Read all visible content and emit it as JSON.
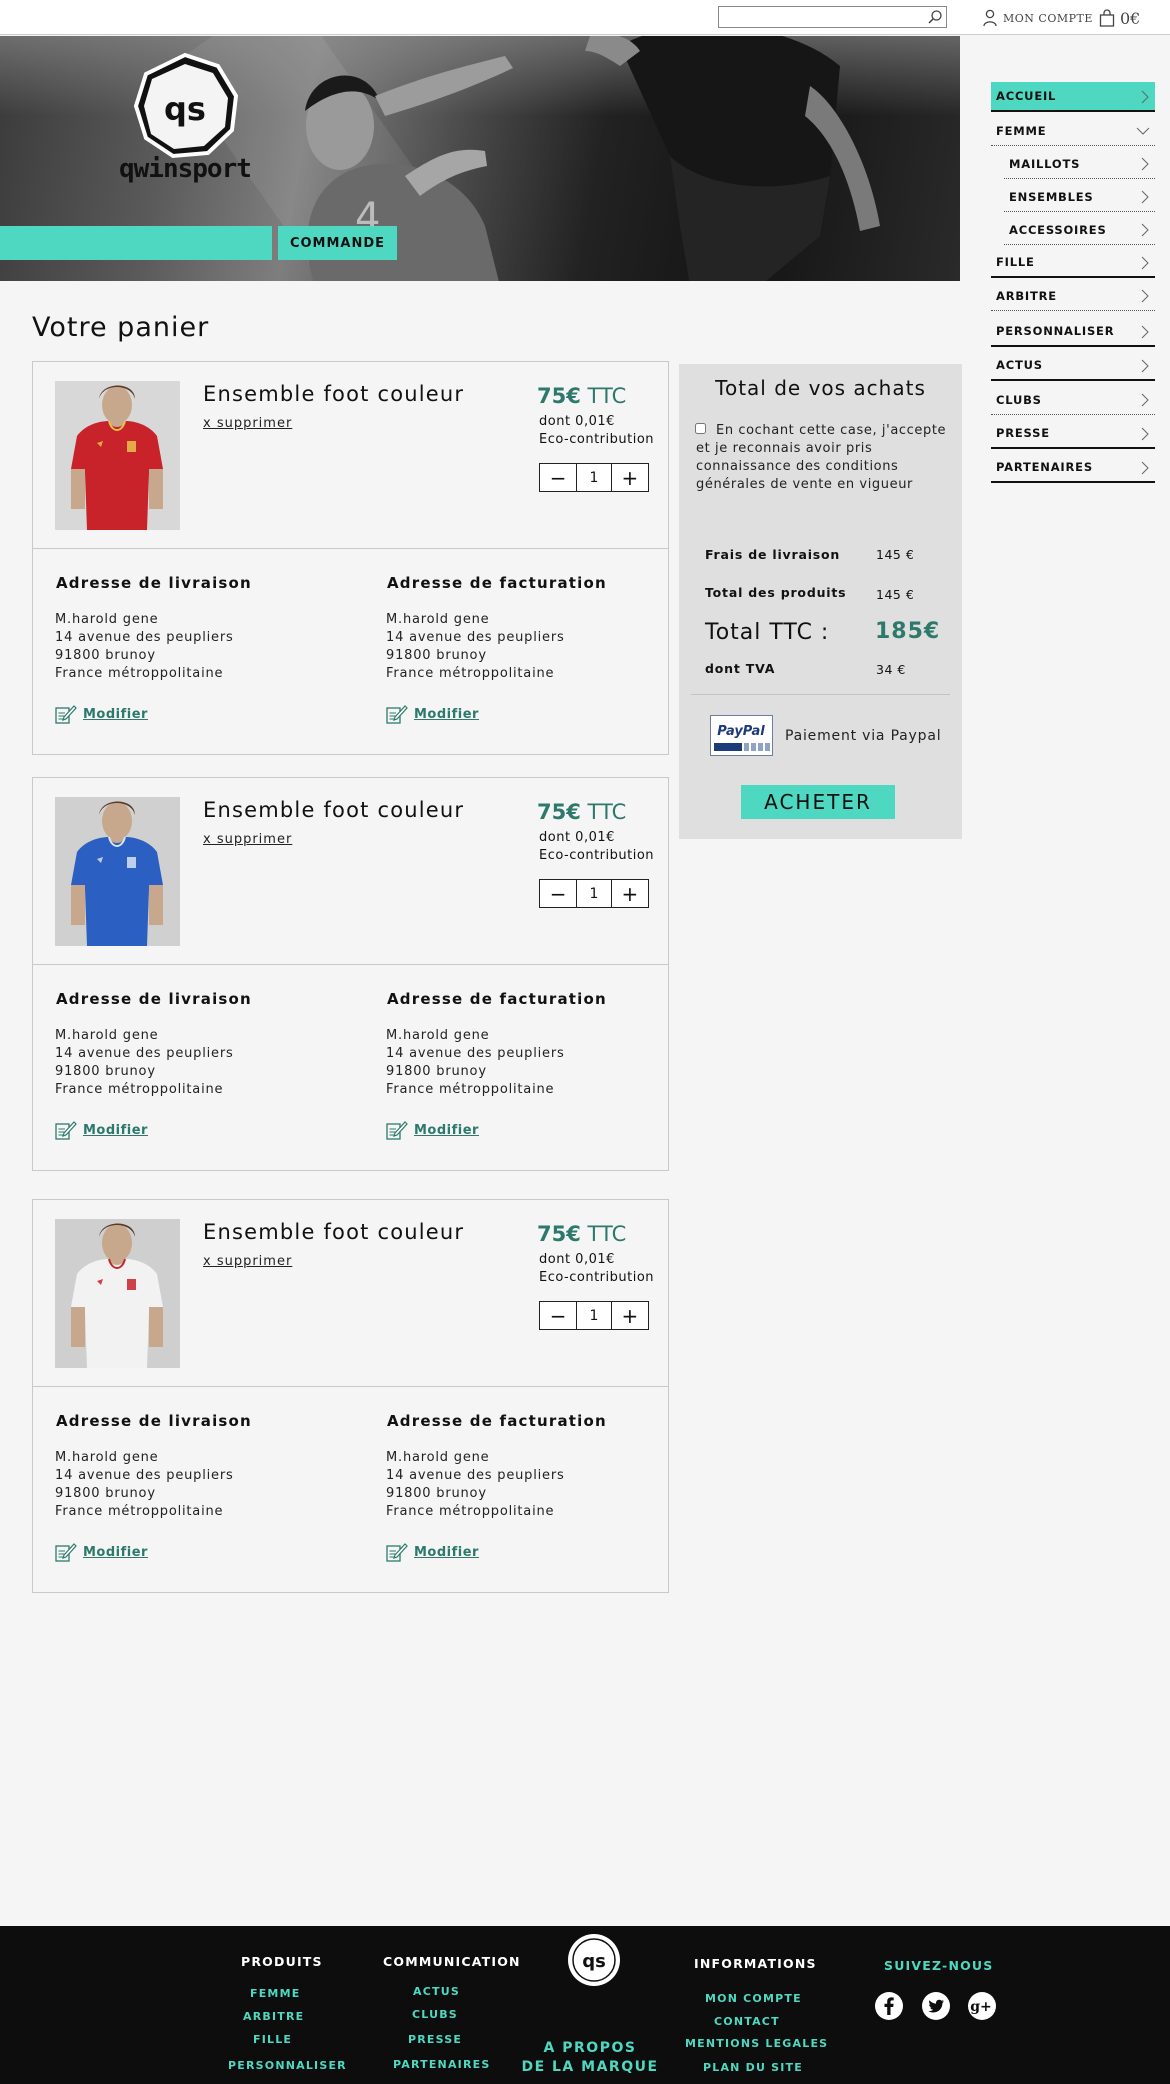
{
  "topbar": {
    "search_placeholder": "",
    "account_label": "MON COMPTE",
    "cart_total": "0€"
  },
  "banner": {
    "logo_text": "qs",
    "brand": "qwinsport",
    "tab_label": "COMMANDE"
  },
  "sidenav": {
    "items": [
      {
        "label": "ACCUEIL",
        "active": true
      },
      {
        "label": "FEMME",
        "expanded": true
      },
      {
        "label": "MAILLOTS",
        "sub": true
      },
      {
        "label": "ENSEMBLES",
        "sub": true
      },
      {
        "label": "ACCESSOIRES",
        "sub": true
      },
      {
        "label": "FILLE"
      },
      {
        "label": "ARBITRE"
      },
      {
        "label": "PERSONNALISER"
      },
      {
        "label": "ACTUS"
      },
      {
        "label": "CLUBS"
      },
      {
        "label": "PRESSE"
      },
      {
        "label": "PARTENAIRES"
      }
    ]
  },
  "page_title": "Votre panier",
  "cart_items": [
    {
      "name": "Ensemble foot couleur",
      "remove_label": "x supprimer",
      "price_amount": "75€",
      "price_suffix": "TTC",
      "eco_amount": "dont 0,01€",
      "eco_label": "Eco-contribution",
      "quantity": "1",
      "jersey": "red",
      "delivery": {
        "title": "Adresse de livraison",
        "lines": [
          "M.harold gene",
          "14 avenue des peupliers",
          "91800 brunoy",
          "France métroppolitaine"
        ],
        "edit": "Modifier"
      },
      "billing": {
        "title": "Adresse de facturation",
        "lines": [
          "M.harold gene",
          "14 avenue des peupliers",
          "91800 brunoy",
          "France métroppolitaine"
        ],
        "edit": "Modifier"
      }
    },
    {
      "name": "Ensemble foot couleur",
      "remove_label": "x supprimer",
      "price_amount": "75€",
      "price_suffix": "TTC",
      "eco_amount": "dont 0,01€",
      "eco_label": "Eco-contribution",
      "quantity": "1",
      "jersey": "blue",
      "delivery": {
        "title": "Adresse de livraison",
        "lines": [
          "M.harold gene",
          "14 avenue des peupliers",
          "91800 brunoy",
          "France métroppolitaine"
        ],
        "edit": "Modifier"
      },
      "billing": {
        "title": "Adresse de facturation",
        "lines": [
          "M.harold gene",
          "14 avenue des peupliers",
          "91800 brunoy",
          "France métroppolitaine"
        ],
        "edit": "Modifier"
      }
    },
    {
      "name": "Ensemble foot couleur",
      "remove_label": "x supprimer",
      "price_amount": "75€",
      "price_suffix": "TTC",
      "eco_amount": "dont 0,01€",
      "eco_label": "Eco-contribution",
      "quantity": "1",
      "jersey": "white",
      "delivery": {
        "title": "Adresse de livraison",
        "lines": [
          "M.harold gene",
          "14 avenue des peupliers",
          "91800 brunoy",
          "France métroppolitaine"
        ],
        "edit": "Modifier"
      },
      "billing": {
        "title": "Adresse de facturation",
        "lines": [
          "M.harold gene",
          "14 avenue des peupliers",
          "91800 brunoy",
          "France métroppolitaine"
        ],
        "edit": "Modifier"
      }
    }
  ],
  "summary": {
    "title": "Total de vos achats",
    "cgv_text": "En cochant cette case, j'accepte et je reconnais avoir pris connaissance des conditions générales de vente en vigueur",
    "shipping_label": "Frais de livraison",
    "shipping_value": "145 €",
    "products_label": "Total des produits",
    "products_value": "145 €",
    "ttc_label": "Total TTC :",
    "ttc_value": "185€",
    "tva_label": "dont TVA",
    "tva_value": "34 €",
    "paypal_logo_text": "PayPal",
    "paypal_label": "Paiement via Paypal",
    "buy_label": "ACHETER"
  },
  "footer": {
    "produits": {
      "title": "PRODUITS",
      "links": [
        "FEMME",
        "ARBITRE",
        "FILLE",
        "PERSONNALISER"
      ]
    },
    "communication": {
      "title": "COMMUNICATION",
      "links": [
        "ACTUS",
        "CLUBS",
        "PRESSE",
        "PARTENAIRES"
      ]
    },
    "logo_text": "qs",
    "about_line1": "A PROPOS",
    "about_line2": "DE LA MARQUE",
    "informations": {
      "title": "INFORMATIONS",
      "links": [
        "MON COMPTE",
        "CONTACT",
        "MENTIONS LEGALES",
        "PLAN DU SITE"
      ]
    },
    "social": {
      "title": "SUIVEZ-NOUS",
      "icons": [
        "facebook-icon",
        "twitter-icon",
        "google-plus-icon"
      ]
    }
  },
  "colors": {
    "accent": "#4ed8c1",
    "price": "#2d7a6c",
    "footer_bg": "#0d0d0d",
    "summary_bg": "#dedfde"
  }
}
